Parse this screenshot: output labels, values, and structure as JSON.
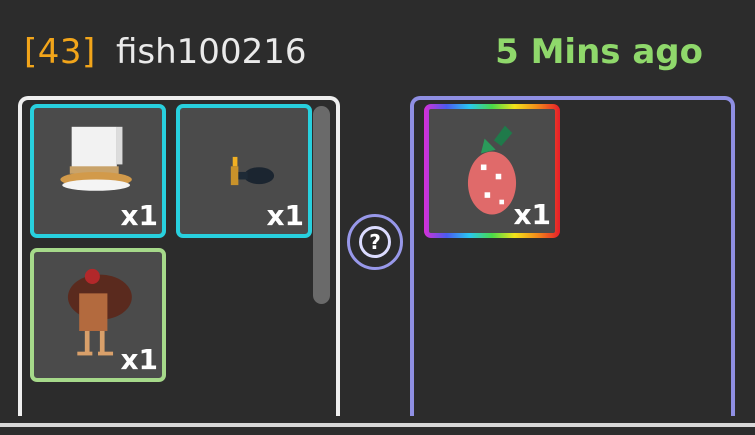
{
  "header": {
    "level": "[43]",
    "username": "fish100216",
    "time_ago": "5 Mins ago"
  },
  "offer": {
    "items": [
      {
        "name": "hat-with-gold-brim",
        "quantity": "x1",
        "rarity_color": "#28d0de"
      },
      {
        "name": "candle-and-rock",
        "quantity": "x1",
        "rarity_color": "#28d0de"
      },
      {
        "name": "turkey-chicken",
        "quantity": "x1",
        "rarity_color": "#a6d98a"
      }
    ]
  },
  "request": {
    "items": [
      {
        "name": "strawberry-pet",
        "quantity": "x1",
        "rarity_color": "rainbow"
      }
    ]
  },
  "help_button": {
    "symbol": "?"
  },
  "colors": {
    "level": "#f2a51a",
    "time_ago": "#8fd86b",
    "right_panel_border": "#8f8fe3"
  }
}
